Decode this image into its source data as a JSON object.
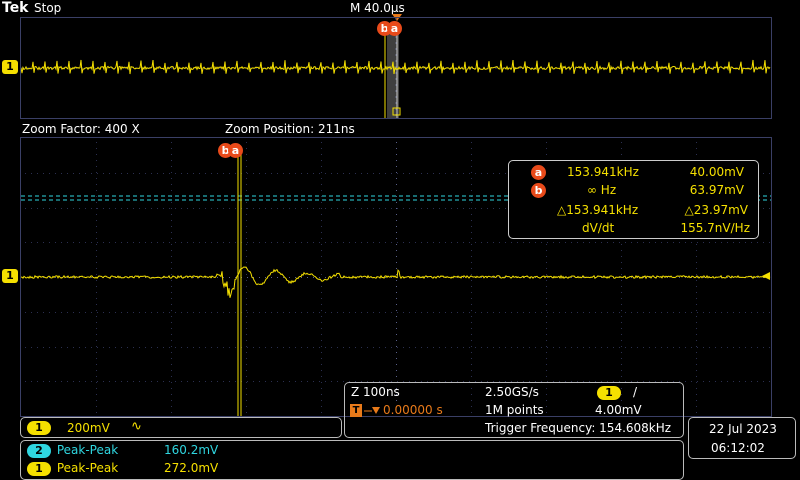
{
  "header": {
    "brand": "Tek",
    "run_state": "Stop",
    "timebase": "M 40.0µs"
  },
  "overview": {
    "channel_marker": "1",
    "cursor_label": "b a"
  },
  "zoom": {
    "factor_label": "Zoom Factor: 400 X",
    "position_label": "Zoom Position: 211ns",
    "channel_marker": "1",
    "cursor_label": "b a"
  },
  "cursor_readout": {
    "a_marker": "a",
    "a_freq": "153.941kHz",
    "a_volt": "40.00mV",
    "b_marker": "b",
    "b_freq": "∞ Hz",
    "b_volt": "63.97mV",
    "delta_freq": "△153.941kHz",
    "delta_volt": "△23.97mV",
    "dvdt_label": "dV/dt",
    "dvdt_value": "155.7nV/Hz"
  },
  "channel_panel": {
    "channel": "1",
    "scale": "200mV",
    "coupling_symbol": "∿"
  },
  "timing_panel": {
    "zoom_scale": "Z 100ns",
    "sample_rate": "2.50GS/s",
    "trigger_channel": "1",
    "trigger_slope": "/",
    "trigger_pos_marker": "T",
    "trigger_pos": "0.00000 s",
    "record_length": "1M points",
    "trigger_level": "4.00mV",
    "trigger_freq": "Trigger Frequency: 154.608kHz"
  },
  "datetime": {
    "date": "22 Jul  2023",
    "time": "06:12:02"
  },
  "measurements": [
    {
      "channel": "2",
      "label": "Peak-Peak",
      "value": "160.2mV",
      "color": "cyan"
    },
    {
      "channel": "1",
      "label": "Peak-Peak",
      "value": "272.0mV",
      "color": "yellow"
    }
  ],
  "colors": {
    "trace": "#f5e000",
    "cursor_marker": "#e84a1a",
    "grid": "#3a3f66",
    "ch2": "#2fd6e0"
  }
}
